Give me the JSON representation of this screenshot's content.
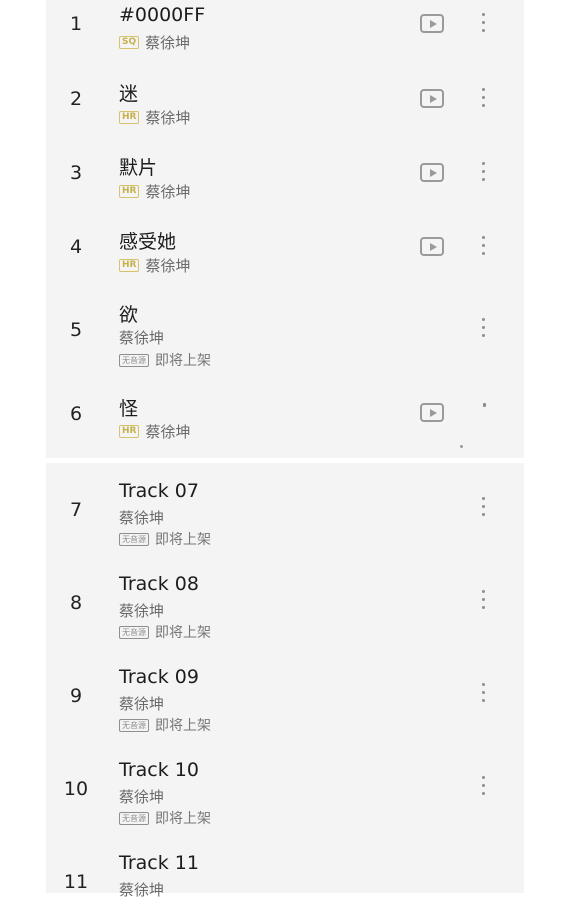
{
  "artist": "蔡徐坤",
  "coming_soon": "即将上架",
  "badges": {
    "sq": "SQ",
    "hr": "HR",
    "no_source": "无音源"
  },
  "tracks": [
    {
      "num": "1",
      "title": "#0000FF",
      "quality": "SQ",
      "playable": true
    },
    {
      "num": "2",
      "title": "迷",
      "quality": "HR",
      "playable": true
    },
    {
      "num": "3",
      "title": "默片",
      "quality": "HR",
      "playable": true
    },
    {
      "num": "4",
      "title": "感受她",
      "quality": "HR",
      "playable": true
    },
    {
      "num": "5",
      "title": "欲",
      "quality": "",
      "playable": false
    },
    {
      "num": "6",
      "title": "怪",
      "quality": "HR",
      "playable": true
    },
    {
      "num": "7",
      "title": "Track 07",
      "quality": "",
      "playable": false
    },
    {
      "num": "8",
      "title": "Track 08",
      "quality": "",
      "playable": false
    },
    {
      "num": "9",
      "title": "Track 09",
      "quality": "",
      "playable": false
    },
    {
      "num": "10",
      "title": "Track 10",
      "quality": "",
      "playable": false
    },
    {
      "num": "11",
      "title": "Track 11",
      "quality": "",
      "playable": false
    }
  ]
}
